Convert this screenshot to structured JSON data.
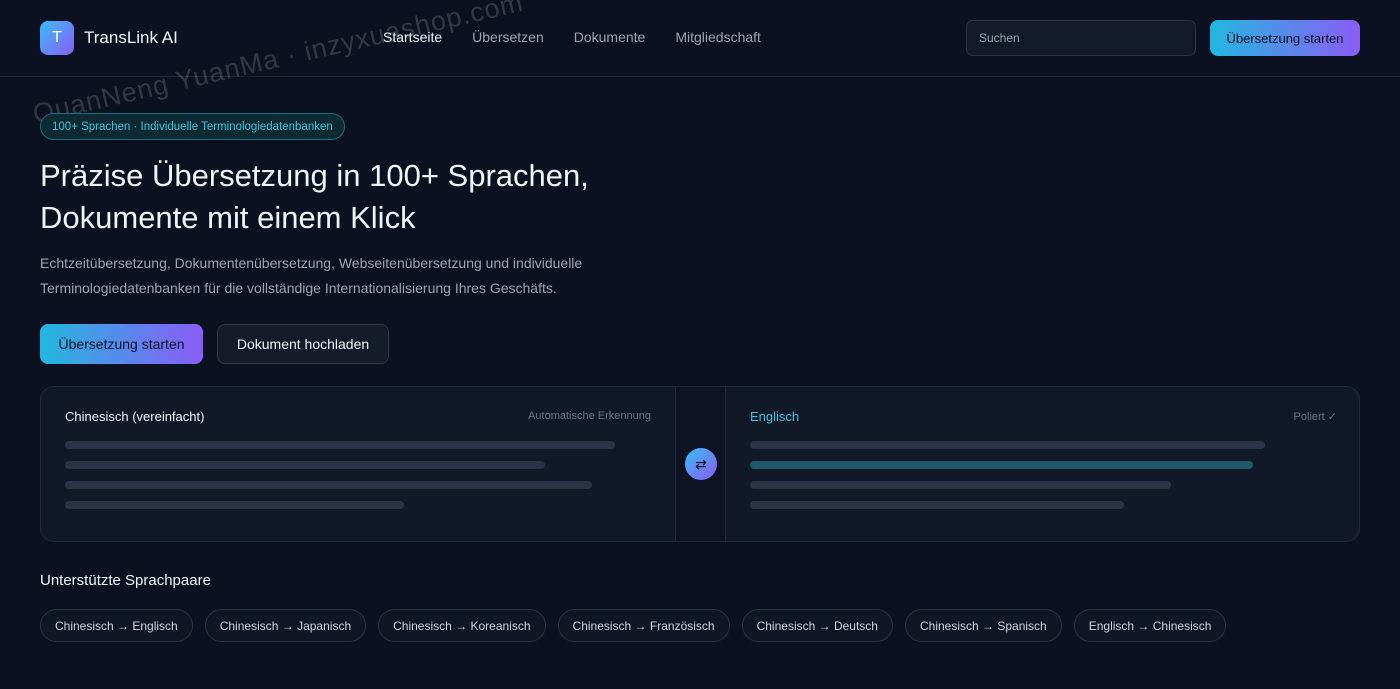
{
  "header": {
    "logo_letter": "T",
    "brand": "TransLink AI",
    "nav": [
      {
        "label": "Startseite",
        "active": true
      },
      {
        "label": "Übersetzen",
        "active": false
      },
      {
        "label": "Dokumente",
        "active": false
      },
      {
        "label": "Mitgliedschaft",
        "active": false
      }
    ],
    "search_placeholder": "Suchen",
    "cta_label": "Übersetzung starten"
  },
  "hero": {
    "badge": "100+ Sprachen · Individuelle Terminologiedatenbanken",
    "title_line1": "Präzise Übersetzung in 100+ Sprachen,",
    "title_line2": "Dokumente mit einem Klick",
    "subtitle_line1": "Echtzeitübersetzung, Dokumentenübersetzung, Webseitenübersetzung und individuelle",
    "subtitle_line2": "Terminologiedatenbanken für die vollständige Internationalisierung Ihres Geschäfts.",
    "primary_button": "Übersetzung starten",
    "secondary_button": "Dokument hochladen"
  },
  "translator": {
    "source_lang": "Chinesisch (vereinfacht)",
    "source_meta": "Automatische Erkennung",
    "swap_icon": "⇄",
    "target_lang": "Englisch",
    "target_meta": "Poliert ✓"
  },
  "pairs": {
    "title": "Unterstützte Sprachpaare",
    "items": [
      "Chinesisch → Englisch",
      "Chinesisch → Japanisch",
      "Chinesisch → Koreanisch",
      "Chinesisch → Französisch",
      "Chinesisch → Deutsch",
      "Chinesisch → Spanisch",
      "Englisch → Chinesisch"
    ]
  },
  "watermark": "QuanNeng YuanMa · inzyxuashop.com",
  "colors": {
    "background": "#0b1120",
    "accent_cyan": "#38c6e0",
    "accent_violet": "#8b5cf6"
  }
}
